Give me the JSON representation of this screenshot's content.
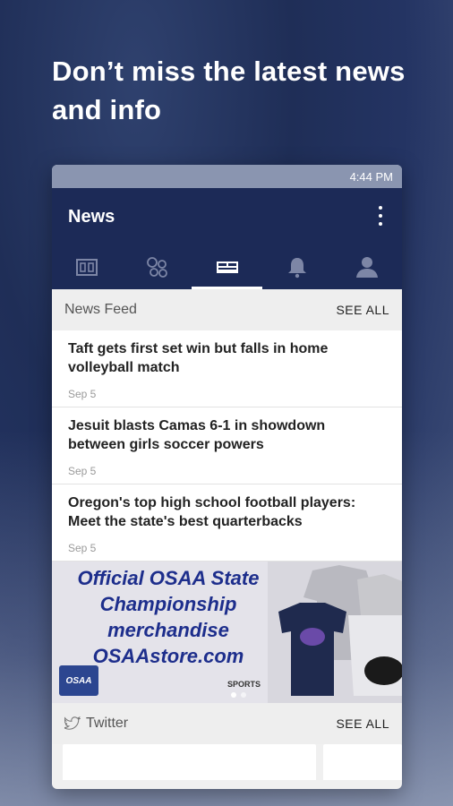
{
  "headline": "Don’t miss the latest news and info",
  "status_bar": {
    "time": "4:44 PM"
  },
  "app_bar": {
    "title": "News"
  },
  "tabs": [
    {
      "icon": "scoreboard-icon"
    },
    {
      "icon": "sports-balls-icon"
    },
    {
      "icon": "news-icon",
      "active": true
    },
    {
      "icon": "bell-icon"
    },
    {
      "icon": "person-icon"
    }
  ],
  "news_feed": {
    "title": "News Feed",
    "see_all": "SEE ALL",
    "items": [
      {
        "title": "Taft gets first set win but falls in home volleyball match",
        "date": "Sep 5"
      },
      {
        "title": "Jesuit blasts Camas 6-1 in showdown between girls soccer powers",
        "date": "Sep 5"
      },
      {
        "title": "Oregon's top high school football players: Meet the state's best quarterbacks",
        "date": "Sep 5"
      }
    ]
  },
  "banner": {
    "text": "Official OSAA State Championship merchandise OSAAstore.com",
    "logo": "OSAA",
    "sponsor": "SPORTS"
  },
  "twitter": {
    "title": "Twitter",
    "see_all": "SEE ALL"
  },
  "colors": {
    "app_bar": "#1c2a57",
    "status_bar": "#8a95b0",
    "banner_text": "#1d2e8c"
  }
}
